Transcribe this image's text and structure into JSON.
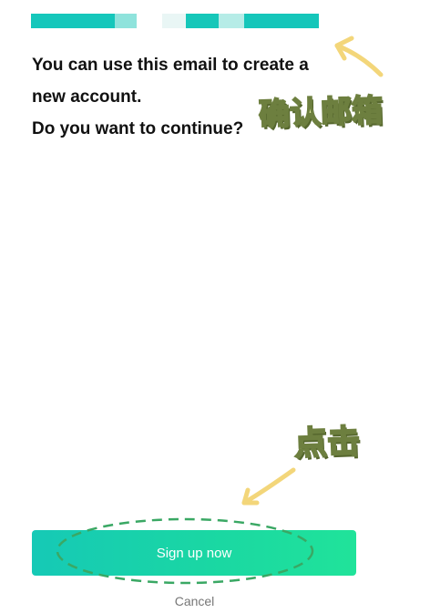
{
  "email": {
    "blurred_segments": [
      "#15c7bb",
      "#8fe3dc",
      "#ffffff",
      "#e9f6f5",
      "#16c7b9",
      "#b6ece7",
      "#15c6ba"
    ]
  },
  "message": {
    "line1": "You can use this email to create a",
    "line2": "new account.",
    "line3": "Do you want to continue?"
  },
  "annotations": {
    "confirm_email": "确认邮箱",
    "click": "点击",
    "arrow_color": "#f3d67a",
    "ellipse_color": "#3aa864"
  },
  "actions": {
    "signup_label": "Sign up now",
    "cancel_label": "Cancel"
  },
  "colors": {
    "button_gradient_start": "#16c9b6",
    "button_gradient_end": "#20e39a",
    "text": "#111111",
    "cancel_text": "#777777"
  }
}
